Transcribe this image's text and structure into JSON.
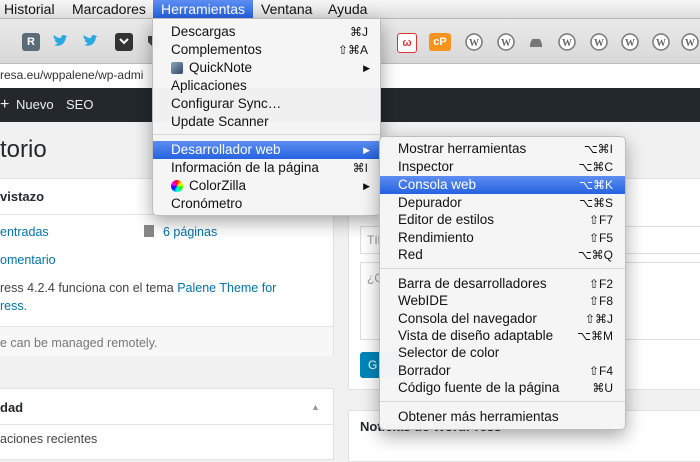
{
  "menubar": {
    "items": [
      "Historial",
      "Marcadores",
      "Herramientas",
      "Ventana",
      "Ayuda"
    ]
  },
  "browser": {
    "url": "resa.eu/wppalene/wp-admi",
    "toolbar_icons": [
      "r-icon",
      "twitter-icon",
      "twitter-icon",
      "pocket-icon",
      "tag-icon",
      "addon-icon",
      "cp-icon",
      "wordpress-icon",
      "wordpress-icon",
      "car-icon",
      "wordpress-icon",
      "wordpress-icon",
      "wordpress-icon",
      "wordpress-icon"
    ],
    "toolbar_glyphs": {
      "r": "R",
      "cp": "cP",
      "addon": "ω"
    }
  },
  "adminbar": {
    "new_label": "Nuevo",
    "seo_label": "SEO",
    "plus": "+"
  },
  "wp": {
    "title": "torio",
    "glance_header": "vistazo",
    "entries": "entradas",
    "pages": "6 páginas",
    "comments": "omentario",
    "theme_line1_pre": "ress 4.2.4 funciona con el tema ",
    "theme_link": "Palene Theme for",
    "theme_line2": "ress.",
    "remote": "e can be managed remotely.",
    "activity_header": "dad",
    "recent": "aciones recientes",
    "draft_title_placeholder": "Tít",
    "draft_content_placeholder": "¿Q",
    "save_btn": "G",
    "news": "Noticias de WordPress"
  },
  "herramientas_menu": {
    "items": [
      {
        "label": "Descargas",
        "shortcut": "⌘J"
      },
      {
        "label": "Complementos",
        "shortcut": "⇧⌘A"
      },
      {
        "label": "QuickNote",
        "shortcut": "",
        "submenu": true
      },
      {
        "label": "Aplicaciones",
        "shortcut": ""
      },
      {
        "label": "Configurar Sync…",
        "shortcut": ""
      },
      {
        "label": "Update Scanner",
        "shortcut": ""
      },
      {
        "label": "Desarrollador web",
        "shortcut": "",
        "submenu": true
      },
      {
        "label": "Información de la página",
        "shortcut": "⌘I"
      },
      {
        "label": "ColorZilla",
        "shortcut": "",
        "submenu": true
      },
      {
        "label": "Cronómetro",
        "shortcut": ""
      }
    ]
  },
  "dev_submenu": {
    "items": [
      {
        "label": "Mostrar herramientas",
        "shortcut": "⌥⌘I"
      },
      {
        "label": "Inspector",
        "shortcut": "⌥⌘C"
      },
      {
        "label": "Consola web",
        "shortcut": "⌥⌘K"
      },
      {
        "label": "Depurador",
        "shortcut": "⌥⌘S"
      },
      {
        "label": "Editor de estilos",
        "shortcut": "⇧F7"
      },
      {
        "label": "Rendimiento",
        "shortcut": "⇧F5"
      },
      {
        "label": "Red",
        "shortcut": "⌥⌘Q"
      },
      {
        "label": "Barra de desarrolladores",
        "shortcut": "⇧F2"
      },
      {
        "label": "WebIDE",
        "shortcut": "⇧F8"
      },
      {
        "label": "Consola del navegador",
        "shortcut": "⇧⌘J"
      },
      {
        "label": "Vista de diseño adaptable",
        "shortcut": "⌥⌘M"
      },
      {
        "label": "Selector de color",
        "shortcut": ""
      },
      {
        "label": "Borrador",
        "shortcut": "⇧F4"
      },
      {
        "label": "Código fuente de la página",
        "shortcut": "⌘U"
      },
      {
        "label": "Obtener más herramientas",
        "shortcut": ""
      }
    ]
  },
  "colors": {
    "highlight": "#2563e1",
    "admin_bar": "#23282d",
    "link": "#0073aa"
  }
}
